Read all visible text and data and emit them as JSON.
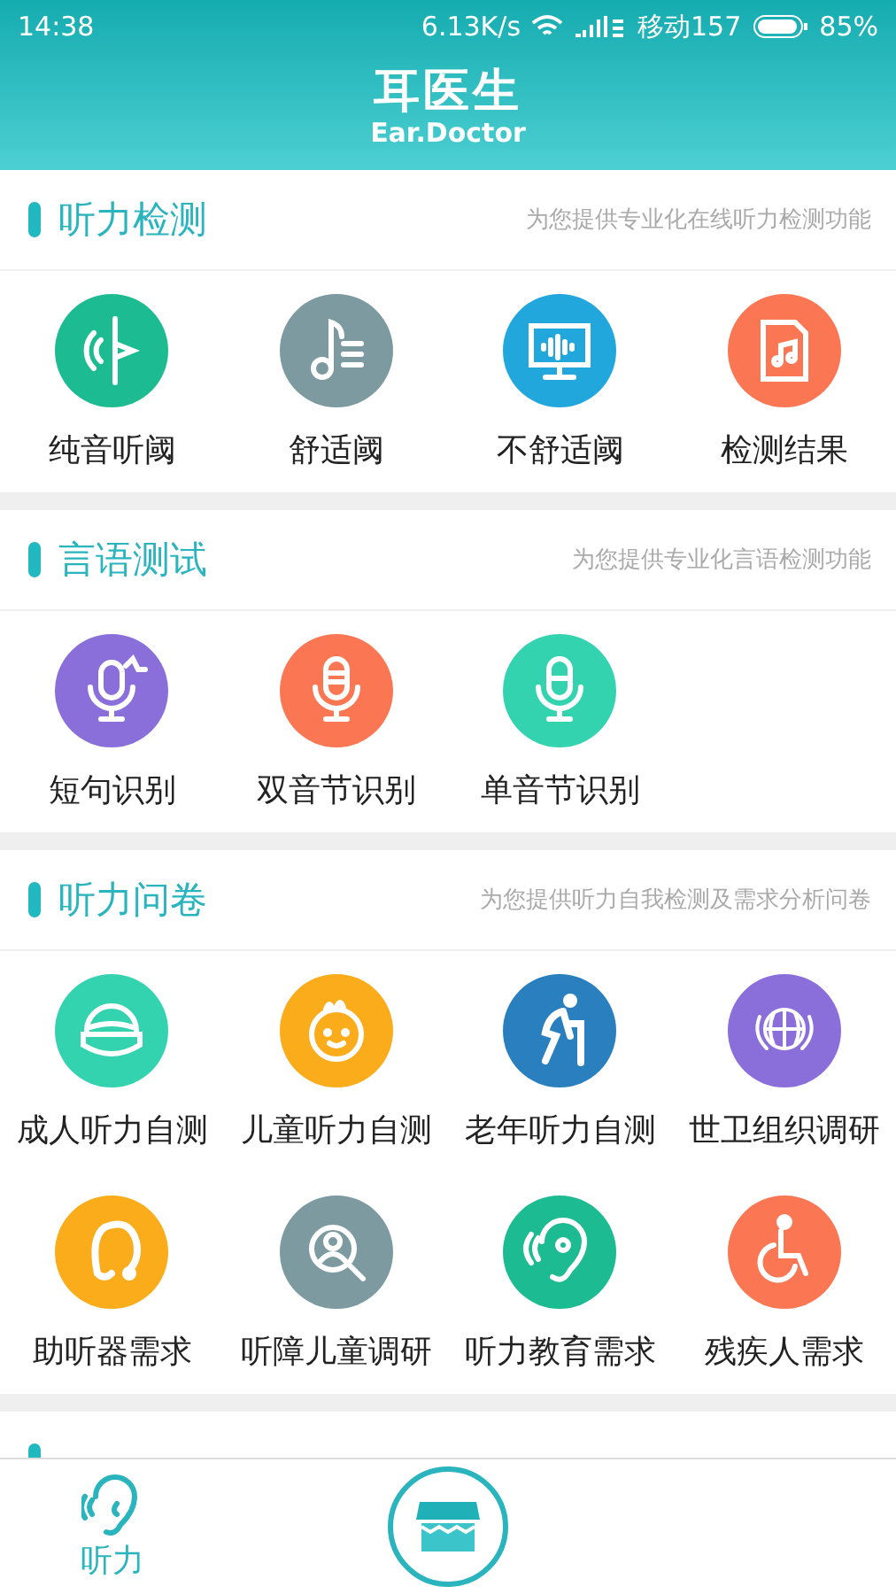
{
  "status_bar": {
    "time": "14:38",
    "speed": "6.13K/s",
    "carrier": "移动157",
    "battery": "85%"
  },
  "header": {
    "title": "耳医生",
    "subtitle": "Ear.Doctor"
  },
  "sections": [
    {
      "title": "听力检测",
      "description": "为您提供专业化在线听力检测功能",
      "items": [
        {
          "label": "纯音听阈",
          "color": "#1dbb91"
        },
        {
          "label": "舒适阈",
          "color": "#7c9aa0"
        },
        {
          "label": "不舒适阈",
          "color": "#22a7dd"
        },
        {
          "label": "检测结果",
          "color": "#fb7653"
        }
      ]
    },
    {
      "title": "言语测试",
      "description": "为您提供专业化言语检测功能",
      "items": [
        {
          "label": "短句识别",
          "color": "#8a6fdb"
        },
        {
          "label": "双音节识别",
          "color": "#fb7653"
        },
        {
          "label": "单音节识别",
          "color": "#34d3b0"
        }
      ]
    },
    {
      "title": "听力问卷",
      "description": "为您提供听力自我检测及需求分析问卷",
      "items": [
        {
          "label": "成人听力自测",
          "color": "#34d3b0"
        },
        {
          "label": "儿童听力自测",
          "color": "#fbac1a"
        },
        {
          "label": "老年听力自测",
          "color": "#2a80bf"
        },
        {
          "label": "世卫组织调研",
          "color": "#8a6fdb"
        },
        {
          "label": "助听器需求",
          "color": "#fbac1a"
        },
        {
          "label": "听障儿童调研",
          "color": "#7c9aa0"
        },
        {
          "label": "听力教育需求",
          "color": "#1dbb91"
        },
        {
          "label": "残疾人需求",
          "color": "#fb7653"
        }
      ]
    }
  ],
  "bottom_nav": [
    {
      "label": "听力",
      "selected": true
    },
    {
      "selected": false
    }
  ]
}
